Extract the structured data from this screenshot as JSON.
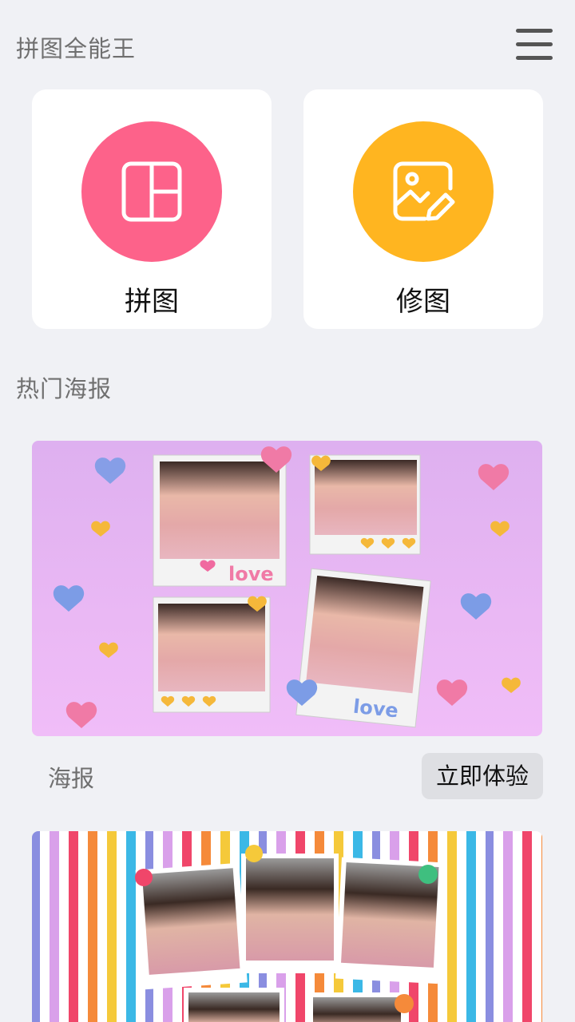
{
  "header": {
    "title": "拼图全能王"
  },
  "tools": [
    {
      "label": "拼图",
      "color": "#fd628a",
      "icon": "collage-layout-icon"
    },
    {
      "label": "修图",
      "color": "#ffb520",
      "icon": "image-edit-icon"
    }
  ],
  "section": {
    "title": "热门海报"
  },
  "posters": [
    {
      "name": "海报",
      "action_label": "立即体验",
      "image_text": [
        "love",
        "love"
      ]
    },
    {
      "name": "",
      "action_label": ""
    }
  ]
}
